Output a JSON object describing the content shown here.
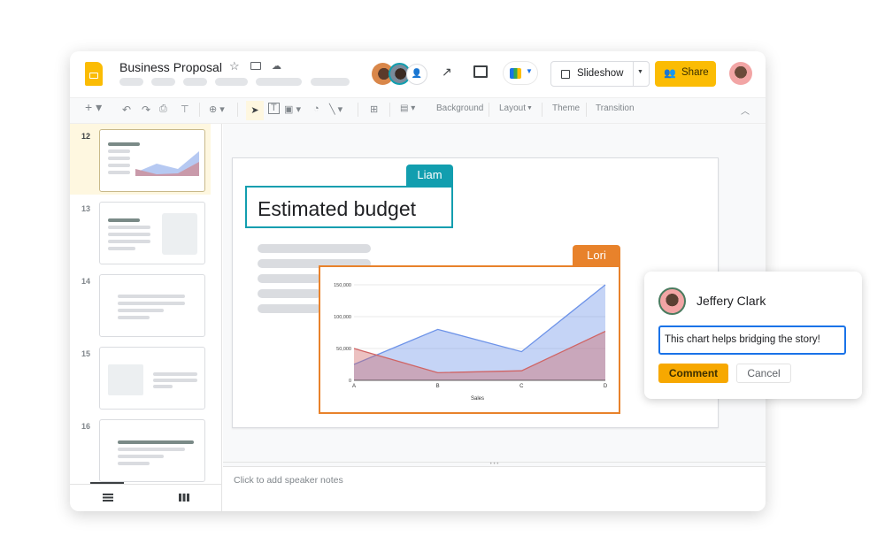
{
  "header": {
    "title": "Business Proposal",
    "slideshow_label": "Slideshow",
    "share_label": "Share"
  },
  "toolbar": {
    "background": "Background",
    "layout": "Layout",
    "theme": "Theme",
    "transition": "Transition"
  },
  "filmstrip": {
    "slides": [
      "12",
      "13",
      "14",
      "15",
      "16"
    ],
    "selected": "12"
  },
  "slide": {
    "title": "Estimated budget",
    "collaborators": [
      {
        "name": "Liam",
        "color": "#129eaf"
      },
      {
        "name": "Lori",
        "color": "#e8822b"
      }
    ]
  },
  "notes": {
    "placeholder": "Click to add speaker notes"
  },
  "comment": {
    "author": "Jeffery Clark",
    "text": "This chart helps bridging the story!",
    "submit": "Comment",
    "cancel": "Cancel"
  },
  "colors": {
    "accent": "#fbbc04",
    "share": "#fbbc04",
    "selection": "#fef7e0"
  },
  "chart_data": {
    "type": "area",
    "categories": [
      "A",
      "B",
      "C",
      "D"
    ],
    "xlabel": "Sales",
    "ylim": [
      0,
      150000
    ],
    "yticks": [
      "0",
      "50,000",
      "100,000",
      "150,000"
    ],
    "series": [
      {
        "values": [
          25000,
          80000,
          45000,
          150000
        ],
        "color": "#6d93e8"
      },
      {
        "values": [
          50000,
          12000,
          15000,
          77000
        ],
        "color": "#d06464"
      }
    ]
  }
}
